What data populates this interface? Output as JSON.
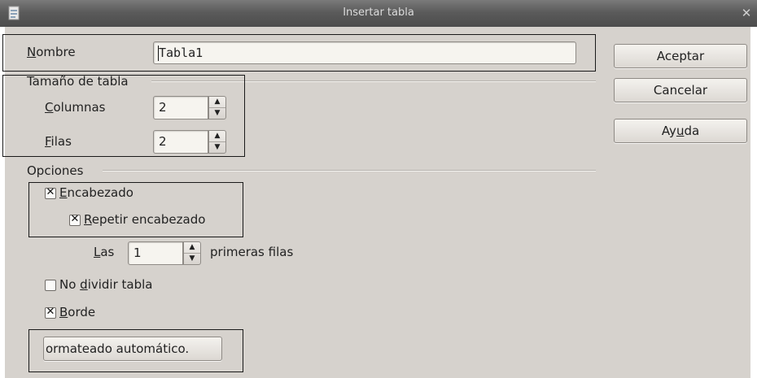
{
  "window": {
    "title": "Insertar tabla",
    "close_glyph": "✕",
    "app_icon": "document-icon"
  },
  "name": {
    "label_mnemonic": "N",
    "label_rest": "ombre",
    "value": "Tabla1"
  },
  "table_size": {
    "heading": "Tamaño de tabla",
    "columns_mnemonic": "C",
    "columns_rest": "olumnas",
    "columns_value": "2",
    "rows_mnemonic": "F",
    "rows_rest": "ilas",
    "rows_value": "2"
  },
  "options": {
    "heading": "Opciones",
    "header": {
      "mnemonic": "E",
      "rest": "ncabezado",
      "checked": true
    },
    "repeat_header": {
      "mnemonic": "R",
      "rest": "epetir encabezado",
      "checked": true
    },
    "first_rows_pre_mnemonic": "L",
    "first_rows_pre_rest": "as",
    "first_rows_value": "1",
    "first_rows_post": "primeras filas",
    "dont_split": {
      "pre": "No ",
      "mnemonic": "d",
      "rest": "ividir tabla",
      "checked": false
    },
    "border": {
      "mnemonic": "B",
      "rest": "orde",
      "checked": true
    },
    "autoformat_label": "ormateado automático."
  },
  "buttons": {
    "ok": "Aceptar",
    "cancel": "Cancelar",
    "help_pre": "Ay",
    "help_mnemonic": "u",
    "help_post": "da"
  },
  "check_glyph": "✕",
  "spin_up": "▲",
  "spin_down": "▼"
}
